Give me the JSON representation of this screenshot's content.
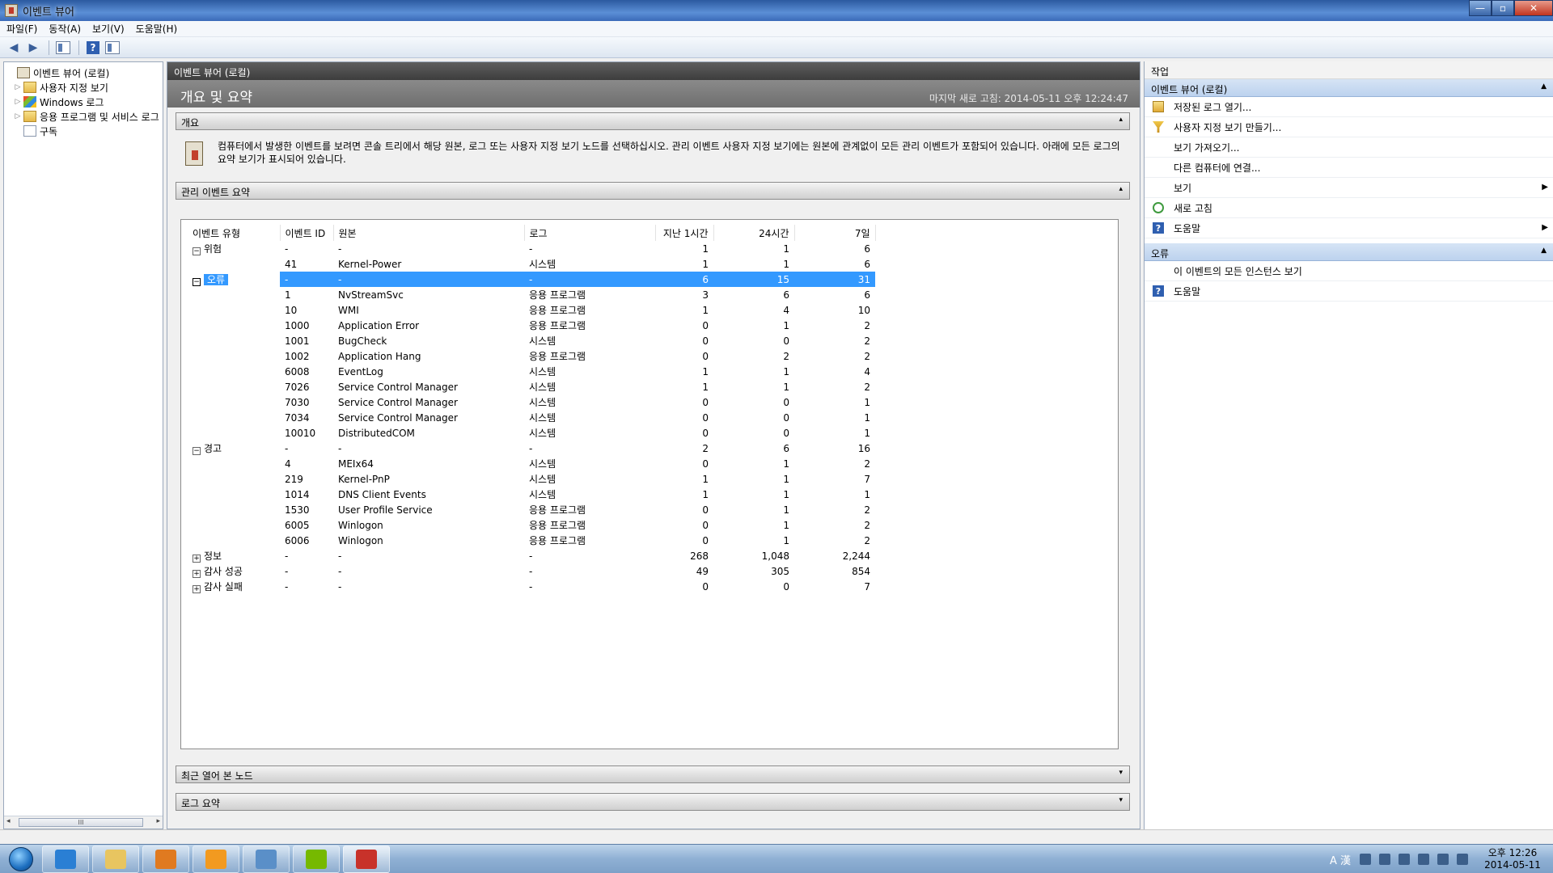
{
  "window": {
    "title": "이벤트 뷰어",
    "buttons": {
      "minimize": "—",
      "maximize": "▫",
      "close": "✕"
    }
  },
  "menu": [
    "파일(F)",
    "동작(A)",
    "보기(V)",
    "도움말(H)"
  ],
  "toolbar": {
    "back_icon": "back-arrow-icon",
    "forward_icon": "forward-arrow-icon",
    "help": "?"
  },
  "tree": {
    "items": [
      {
        "label": "이벤트 뷰어 (로컬)",
        "icon": "event-viewer-icon",
        "expander": ""
      },
      {
        "label": "사용자 지정 보기",
        "icon": "folder-icon",
        "expander": "▷"
      },
      {
        "label": "Windows 로그",
        "icon": "windows-icon",
        "expander": "▷"
      },
      {
        "label": "응용 프로그램 및 서비스 로그",
        "icon": "folder-icon",
        "expander": "▷"
      },
      {
        "label": "구독",
        "icon": "subscription-icon",
        "expander": ""
      }
    ],
    "scroll_thumb": "III"
  },
  "center": {
    "header": "이벤트 뷰어 (로컬)",
    "banner_title": "개요 및 요약",
    "last_refresh": "마지막 새로 고침: 2014-05-11 오후 12:24:47",
    "overview": {
      "label": "개요",
      "text": "컴퓨터에서 발생한 이벤트를 보려면 콘솔 트리에서 해당 원본, 로그 또는 사용자 지정 보기 노드를 선택하십시오. 관리 이벤트 사용자 지정 보기에는 원본에 관계없이 모든 관리 이벤트가 포함되어 있습니다. 아래에 모든 로그의 요약 보기가 표시되어 있습니다."
    },
    "summary_label": "관리 이벤트 요약",
    "recent_label": "최근 열어 본 노드",
    "log_summary_label": "로그 요약",
    "columns": [
      "이벤트 유형",
      "이벤트 ID",
      "원본",
      "로그",
      "지난 1시간",
      "24시간",
      "7일"
    ],
    "rows": [
      {
        "type": "위험",
        "toggle": "−",
        "id": "-",
        "source": "-",
        "log": "-",
        "h1": "1",
        "h24": "1",
        "d7": "6",
        "selected": false
      },
      {
        "type": "",
        "toggle": "",
        "id": "41",
        "source": "Kernel-Power",
        "log": "시스템",
        "h1": "1",
        "h24": "1",
        "d7": "6",
        "selected": false
      },
      {
        "type": "오류",
        "toggle": "−",
        "id": "-",
        "source": "-",
        "log": "-",
        "h1": "6",
        "h24": "15",
        "d7": "31",
        "selected": true
      },
      {
        "type": "",
        "toggle": "",
        "id": "1",
        "source": "NvStreamSvc",
        "log": "응용 프로그램",
        "h1": "3",
        "h24": "6",
        "d7": "6",
        "selected": false
      },
      {
        "type": "",
        "toggle": "",
        "id": "10",
        "source": "WMI",
        "log": "응용 프로그램",
        "h1": "1",
        "h24": "4",
        "d7": "10",
        "selected": false
      },
      {
        "type": "",
        "toggle": "",
        "id": "1000",
        "source": "Application Error",
        "log": "응용 프로그램",
        "h1": "0",
        "h24": "1",
        "d7": "2",
        "selected": false
      },
      {
        "type": "",
        "toggle": "",
        "id": "1001",
        "source": "BugCheck",
        "log": "시스템",
        "h1": "0",
        "h24": "0",
        "d7": "2",
        "selected": false
      },
      {
        "type": "",
        "toggle": "",
        "id": "1002",
        "source": "Application Hang",
        "log": "응용 프로그램",
        "h1": "0",
        "h24": "2",
        "d7": "2",
        "selected": false
      },
      {
        "type": "",
        "toggle": "",
        "id": "6008",
        "source": "EventLog",
        "log": "시스템",
        "h1": "1",
        "h24": "1",
        "d7": "4",
        "selected": false
      },
      {
        "type": "",
        "toggle": "",
        "id": "7026",
        "source": "Service Control Manager",
        "log": "시스템",
        "h1": "1",
        "h24": "1",
        "d7": "2",
        "selected": false
      },
      {
        "type": "",
        "toggle": "",
        "id": "7030",
        "source": "Service Control Manager",
        "log": "시스템",
        "h1": "0",
        "h24": "0",
        "d7": "1",
        "selected": false
      },
      {
        "type": "",
        "toggle": "",
        "id": "7034",
        "source": "Service Control Manager",
        "log": "시스템",
        "h1": "0",
        "h24": "0",
        "d7": "1",
        "selected": false
      },
      {
        "type": "",
        "toggle": "",
        "id": "10010",
        "source": "DistributedCOM",
        "log": "시스템",
        "h1": "0",
        "h24": "0",
        "d7": "1",
        "selected": false
      },
      {
        "type": "경고",
        "toggle": "−",
        "id": "-",
        "source": "-",
        "log": "-",
        "h1": "2",
        "h24": "6",
        "d7": "16",
        "selected": false
      },
      {
        "type": "",
        "toggle": "",
        "id": "4",
        "source": "MEIx64",
        "log": "시스템",
        "h1": "0",
        "h24": "1",
        "d7": "2",
        "selected": false
      },
      {
        "type": "",
        "toggle": "",
        "id": "219",
        "source": "Kernel-PnP",
        "log": "시스템",
        "h1": "1",
        "h24": "1",
        "d7": "7",
        "selected": false
      },
      {
        "type": "",
        "toggle": "",
        "id": "1014",
        "source": "DNS Client Events",
        "log": "시스템",
        "h1": "1",
        "h24": "1",
        "d7": "1",
        "selected": false
      },
      {
        "type": "",
        "toggle": "",
        "id": "1530",
        "source": "User Profile Service",
        "log": "응용 프로그램",
        "h1": "0",
        "h24": "1",
        "d7": "2",
        "selected": false
      },
      {
        "type": "",
        "toggle": "",
        "id": "6005",
        "source": "Winlogon",
        "log": "응용 프로그램",
        "h1": "0",
        "h24": "1",
        "d7": "2",
        "selected": false
      },
      {
        "type": "",
        "toggle": "",
        "id": "6006",
        "source": "Winlogon",
        "log": "응용 프로그램",
        "h1": "0",
        "h24": "1",
        "d7": "2",
        "selected": false
      },
      {
        "type": "정보",
        "toggle": "+",
        "id": "-",
        "source": "-",
        "log": "-",
        "h1": "268",
        "h24": "1,048",
        "d7": "2,244",
        "selected": false
      },
      {
        "type": "감사 성공",
        "toggle": "+",
        "id": "-",
        "source": "-",
        "log": "-",
        "h1": "49",
        "h24": "305",
        "d7": "854",
        "selected": false
      },
      {
        "type": "감사 실패",
        "toggle": "+",
        "id": "-",
        "source": "-",
        "log": "-",
        "h1": "0",
        "h24": "0",
        "d7": "7",
        "selected": false
      }
    ]
  },
  "actions": {
    "header": "작업",
    "groups": [
      {
        "title": "이벤트 뷰어 (로컬)",
        "items": [
          {
            "label": "저장된 로그 열기...",
            "icon": "open-log-icon",
            "submenu": false
          },
          {
            "label": "사용자 지정 보기 만들기...",
            "icon": "filter-icon",
            "submenu": false
          },
          {
            "label": "보기 가져오기...",
            "icon": "",
            "submenu": false
          },
          {
            "label": "다른 컴퓨터에 연결...",
            "icon": "",
            "submenu": false
          },
          {
            "label": "보기",
            "icon": "",
            "submenu": true
          },
          {
            "label": "새로 고침",
            "icon": "refresh-icon",
            "submenu": false
          },
          {
            "label": "도움말",
            "icon": "help-icon",
            "submenu": true
          }
        ]
      },
      {
        "title": "오류",
        "items": [
          {
            "label": "이 이벤트의 모든 인스턴스 보기",
            "icon": "",
            "submenu": false
          },
          {
            "label": "도움말",
            "icon": "help-icon",
            "submenu": false
          }
        ]
      }
    ]
  },
  "taskbar": {
    "apps": [
      {
        "name": "internet-explorer",
        "color": "#2a7fd4"
      },
      {
        "name": "file-explorer",
        "color": "#e8c560"
      },
      {
        "name": "media-player",
        "color": "#e07a20"
      },
      {
        "name": "weather-gadget",
        "color": "#f29a20"
      },
      {
        "name": "control-panel",
        "color": "#5a8fc8"
      },
      {
        "name": "nvidia",
        "color": "#76b900"
      },
      {
        "name": "toolbox",
        "color": "#c8322a"
      }
    ],
    "ime": "A 漢",
    "clock_time": "오후 12:26",
    "clock_date": "2014-05-11"
  }
}
